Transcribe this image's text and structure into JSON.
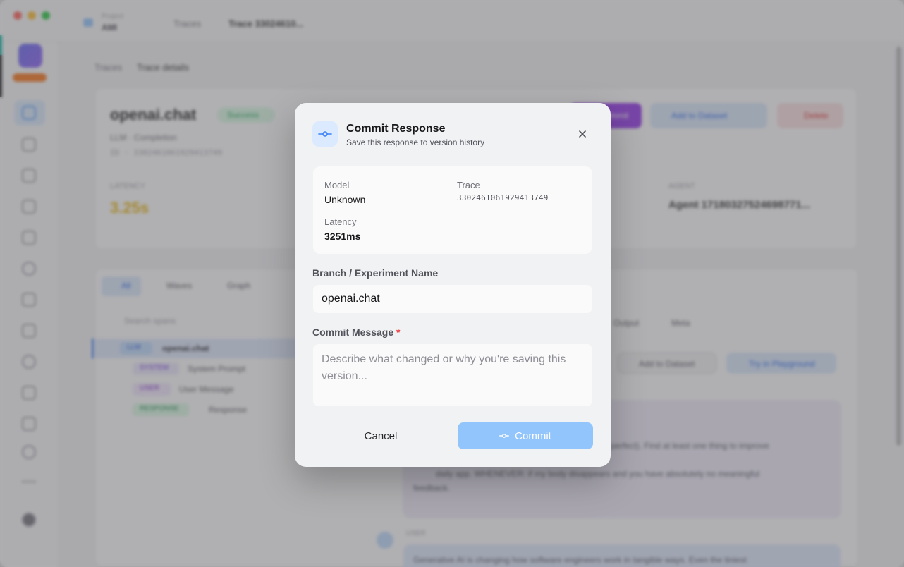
{
  "background": {
    "workspace_label_top": "Project",
    "workspace_label": "AMI",
    "top_crumbs": [
      "Traces",
      "Trace 33024610..."
    ],
    "page_breadcrumb": [
      "Traces",
      "Trace details"
    ],
    "trace_title": "openai.chat",
    "status_badge": "Success",
    "trace_kind": "LLM · Completion",
    "trace_id_line": "ID · 3302461061929413749",
    "stats": [
      {
        "label": "LATENCY",
        "value": "3.25s"
      },
      {
        "label": "AGENT",
        "value": "Agent 17180327524698771..."
      }
    ],
    "header_buttons": [
      "Commit",
      "Add to Dataset",
      "Delete"
    ],
    "tabs": [
      "All",
      "Waves",
      "Graph"
    ],
    "search_placeholder": "Search spans",
    "tree_rows": [
      {
        "tag": "LLM",
        "label": "openai.chat"
      },
      {
        "tag": "SYSTEM",
        "label": "System Prompt"
      },
      {
        "tag": "USER",
        "label": "User Message"
      },
      {
        "tag": "RESPONSE",
        "label": "Response"
      }
    ],
    "panel_buttons": [
      "Add to Dataset",
      "Try in Playground"
    ],
    "panel_tabs": [
      "Output",
      "Meta"
    ],
    "message_lines": [
      "perfect). Find at least one thing to improve",
      "daily app. WHENEVER: if my body disappears and you have absolutely no meaningful",
      "feedback.",
      "Generative AI is changing how software engineers work in tangible ways. Even the tiniest"
    ],
    "message_label": "USER"
  },
  "modal": {
    "icon": "commit-icon",
    "title": "Commit Response",
    "subtitle": "Save this response to version history",
    "info": {
      "model_label": "Model",
      "model_value": "Unknown",
      "trace_label": "Trace",
      "trace_value": "3302461061929413749",
      "latency_label": "Latency",
      "latency_value": "3251ms"
    },
    "branch_label": "Branch / Experiment Name",
    "branch_value": "openai.chat",
    "message_label": "Commit Message",
    "required_mark": "*",
    "message_placeholder": "Describe what changed or why you're saving this version...",
    "message_value": "",
    "cancel_label": "Cancel",
    "commit_label": "Commit"
  },
  "colors": {
    "accent": "#3b82f6",
    "commit_button_disabled": "#93c5fd",
    "required": "#ef4444"
  }
}
